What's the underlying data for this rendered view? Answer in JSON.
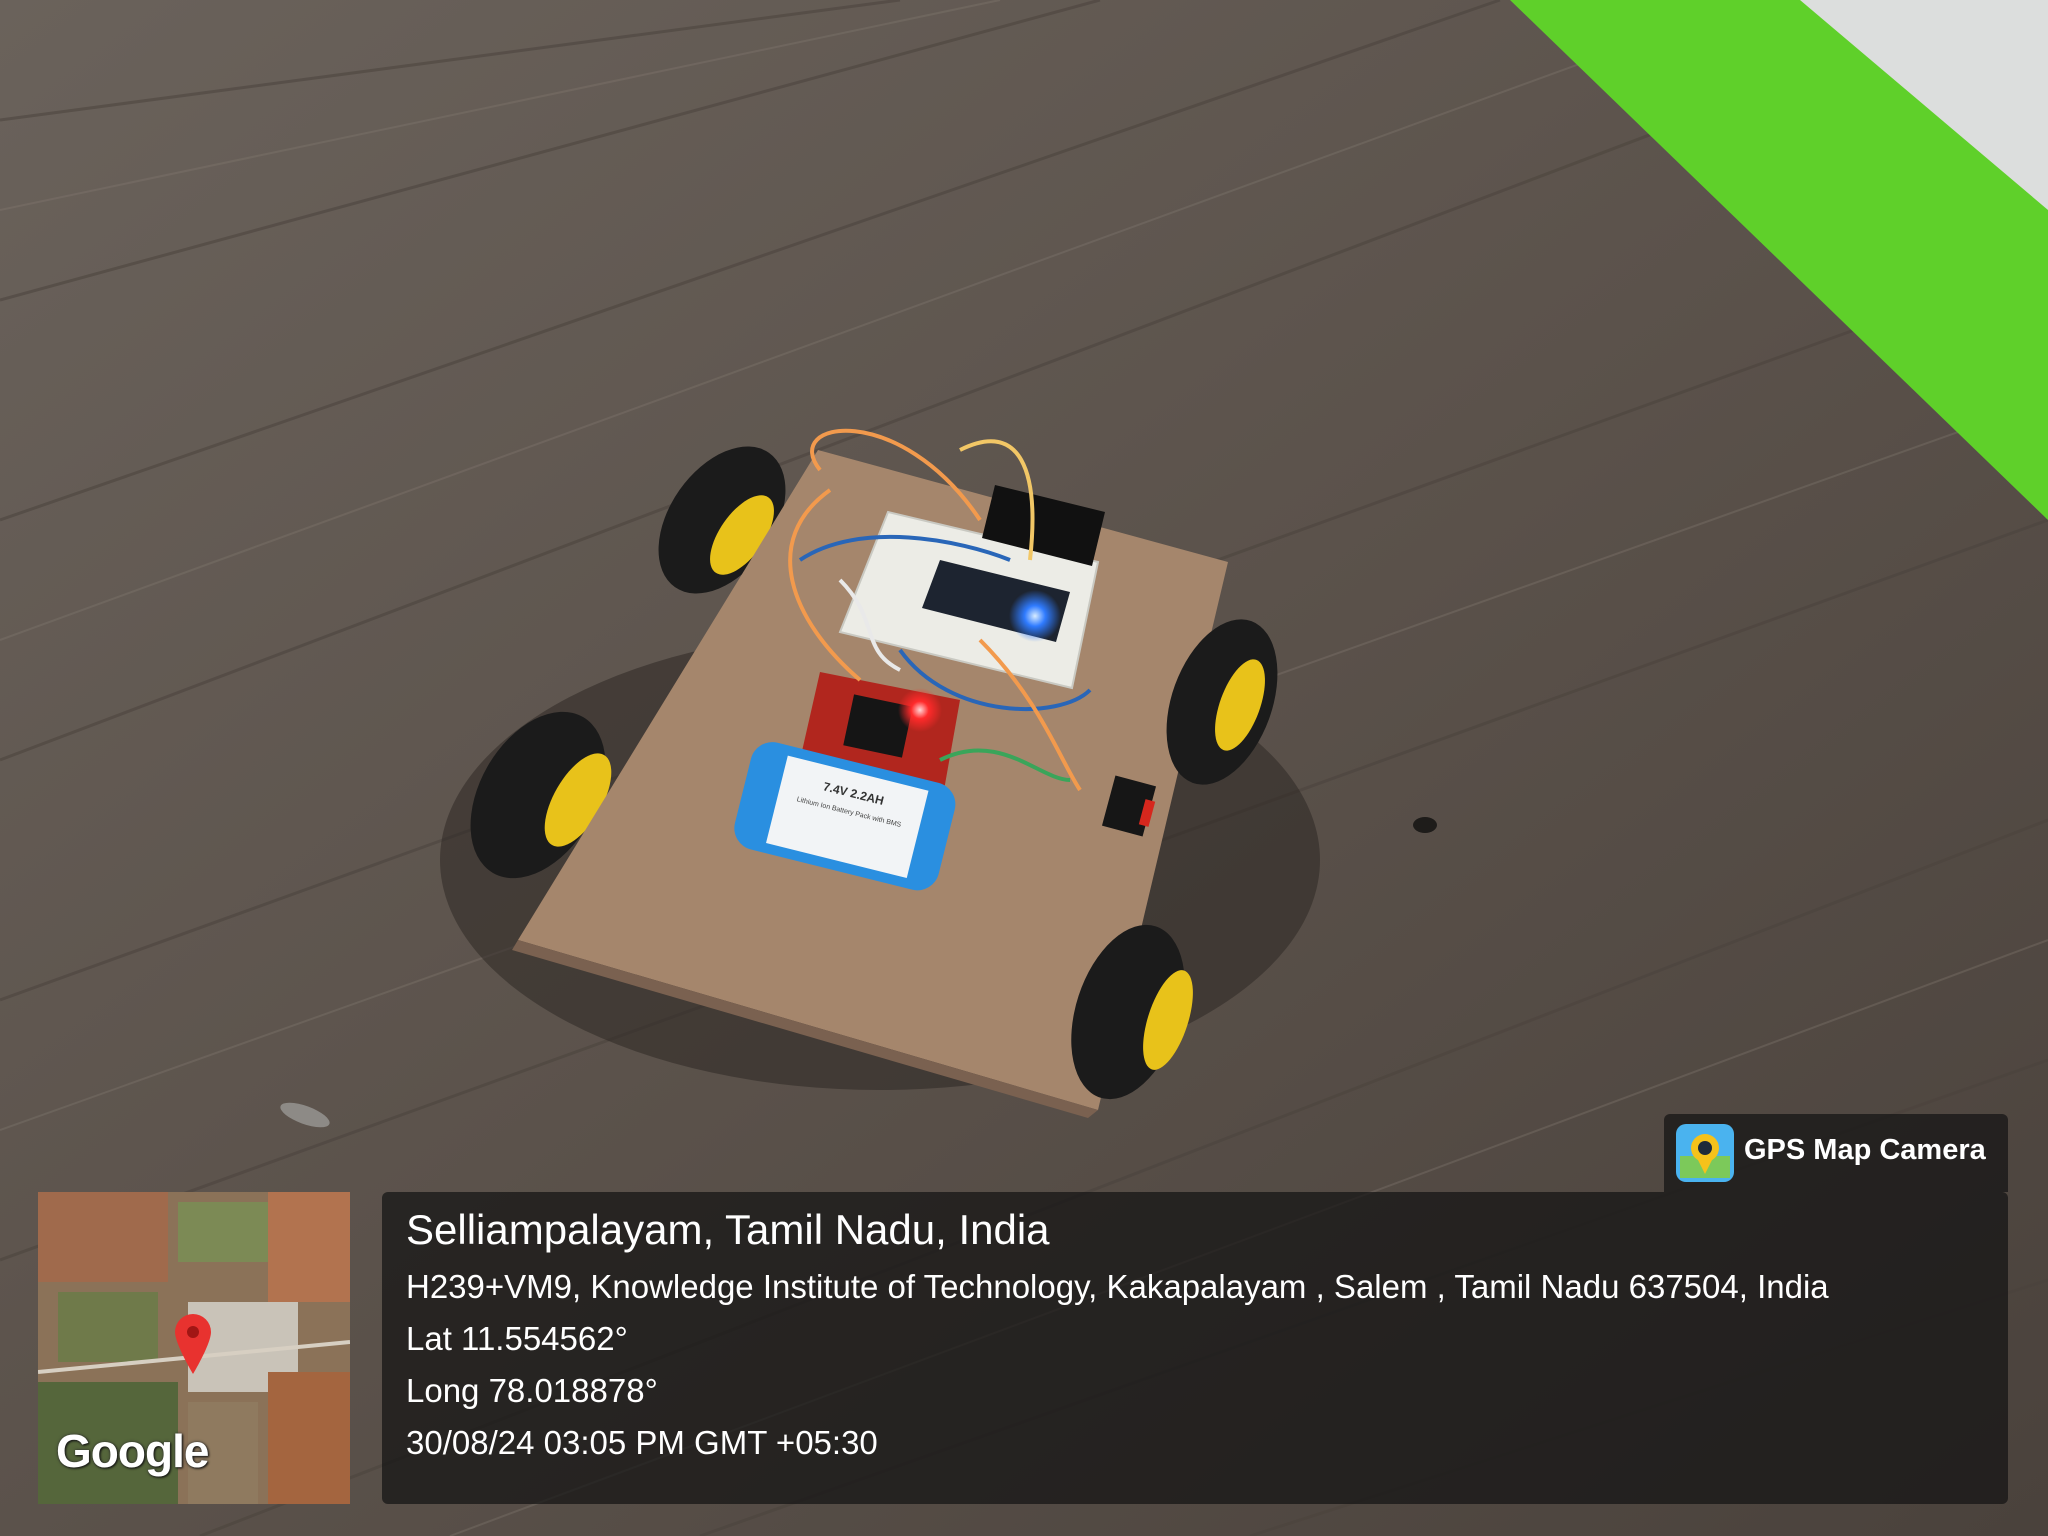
{
  "photo": {
    "subject": "robot-car",
    "battery_label_lines": [
      "7.4V 2.2AH",
      "Lithium Ion Battery Pack with BMS"
    ]
  },
  "overlay": {
    "brand": "GPS Map Camera",
    "brand_icon": "gps-camera-icon",
    "location_title": "Selliampalayam, Tamil Nadu, India",
    "address": "H239+VM9, Knowledge Institute of Technology, Kakapalayam , Salem , Tamil Nadu 637504, India",
    "latitude": "Lat 11.554562°",
    "longitude": "Long 78.018878°",
    "datetime": "30/08/24 03:05 PM GMT +05:30",
    "map_logo": "Google",
    "map_marker_icon": "map-pin-icon"
  },
  "colors": {
    "floor": "#5d544d",
    "wall_green": "#5fd02a",
    "board": "#a5866c",
    "battery": "#2a8fe0",
    "wheel_hub": "#e8c21a",
    "overlay_bg": "rgba(20,20,20,0.72)"
  }
}
